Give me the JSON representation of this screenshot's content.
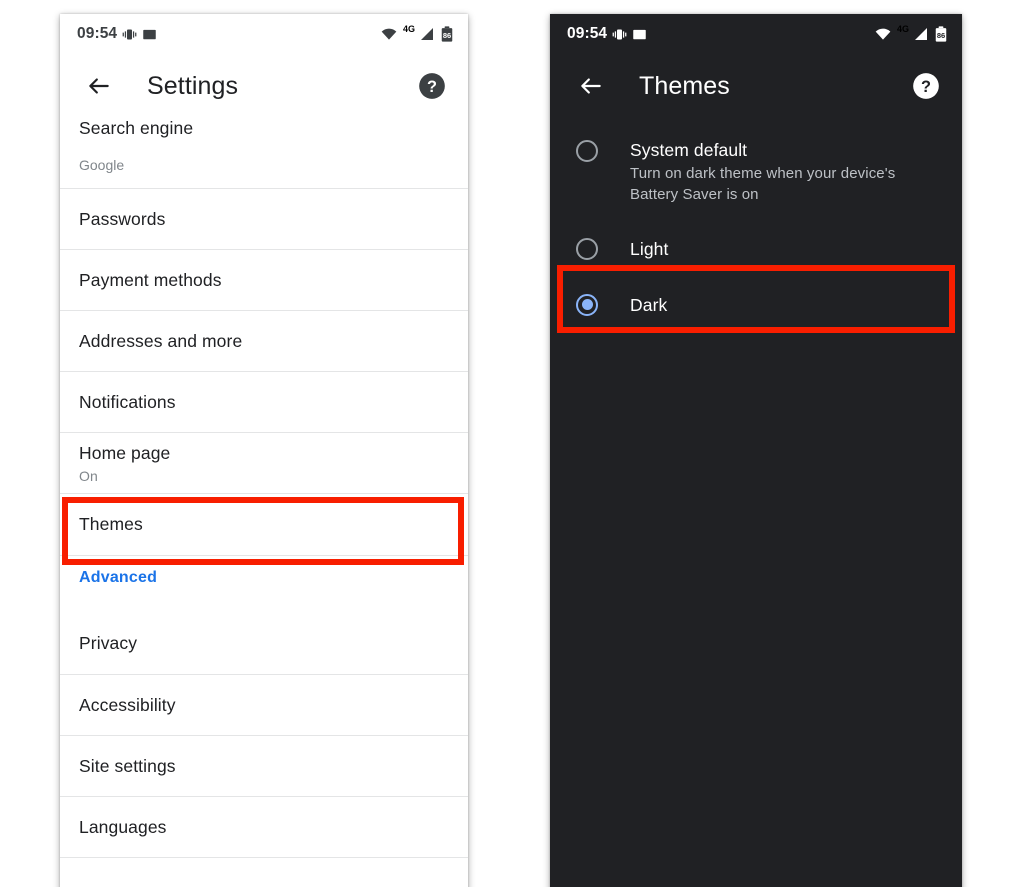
{
  "colors": {
    "accent_blue": "#1a73e8",
    "dark_accent_blue": "#8ab4f8",
    "highlight_red": "#f81e00",
    "dark_surface": "#202124",
    "light_surface": "#ffffff"
  },
  "status_bar": {
    "time": "09:54",
    "vibrate_icon": "vibrate-icon",
    "photo_icon": "photo-icon",
    "wifi_icon": "wifi-icon",
    "network_type": "4G",
    "signal_icon": "cellular-signal-icon",
    "battery_level": "86"
  },
  "left_phone": {
    "app_bar": {
      "back_icon": "back-arrow-icon",
      "title": "Settings",
      "help_icon": "help-icon"
    },
    "items": [
      {
        "title": "Search engine",
        "subtitle": "Google",
        "kind": "partial"
      },
      {
        "title": "Passwords",
        "subtitle": "",
        "kind": "row"
      },
      {
        "title": "Payment methods",
        "subtitle": "",
        "kind": "row"
      },
      {
        "title": "Addresses and more",
        "subtitle": "",
        "kind": "row"
      },
      {
        "title": "Notifications",
        "subtitle": "",
        "kind": "row"
      },
      {
        "title": "Home page",
        "subtitle": "On",
        "kind": "row"
      },
      {
        "title": "Themes",
        "subtitle": "",
        "kind": "row",
        "highlighted": true
      },
      {
        "title": "Advanced",
        "subtitle": "",
        "kind": "section"
      },
      {
        "title": "Privacy",
        "subtitle": "",
        "kind": "row"
      },
      {
        "title": "Accessibility",
        "subtitle": "",
        "kind": "row"
      },
      {
        "title": "Site settings",
        "subtitle": "",
        "kind": "row"
      },
      {
        "title": "Languages",
        "subtitle": "",
        "kind": "row"
      }
    ]
  },
  "right_phone": {
    "app_bar": {
      "back_icon": "back-arrow-icon",
      "title": "Themes",
      "help_icon": "help-icon"
    },
    "options": [
      {
        "label": "System default",
        "description": "Turn on dark theme when your device's Battery Saver is on",
        "selected": false
      },
      {
        "label": "Light",
        "description": "",
        "selected": false
      },
      {
        "label": "Dark",
        "description": "",
        "selected": true,
        "highlighted": true
      }
    ]
  }
}
